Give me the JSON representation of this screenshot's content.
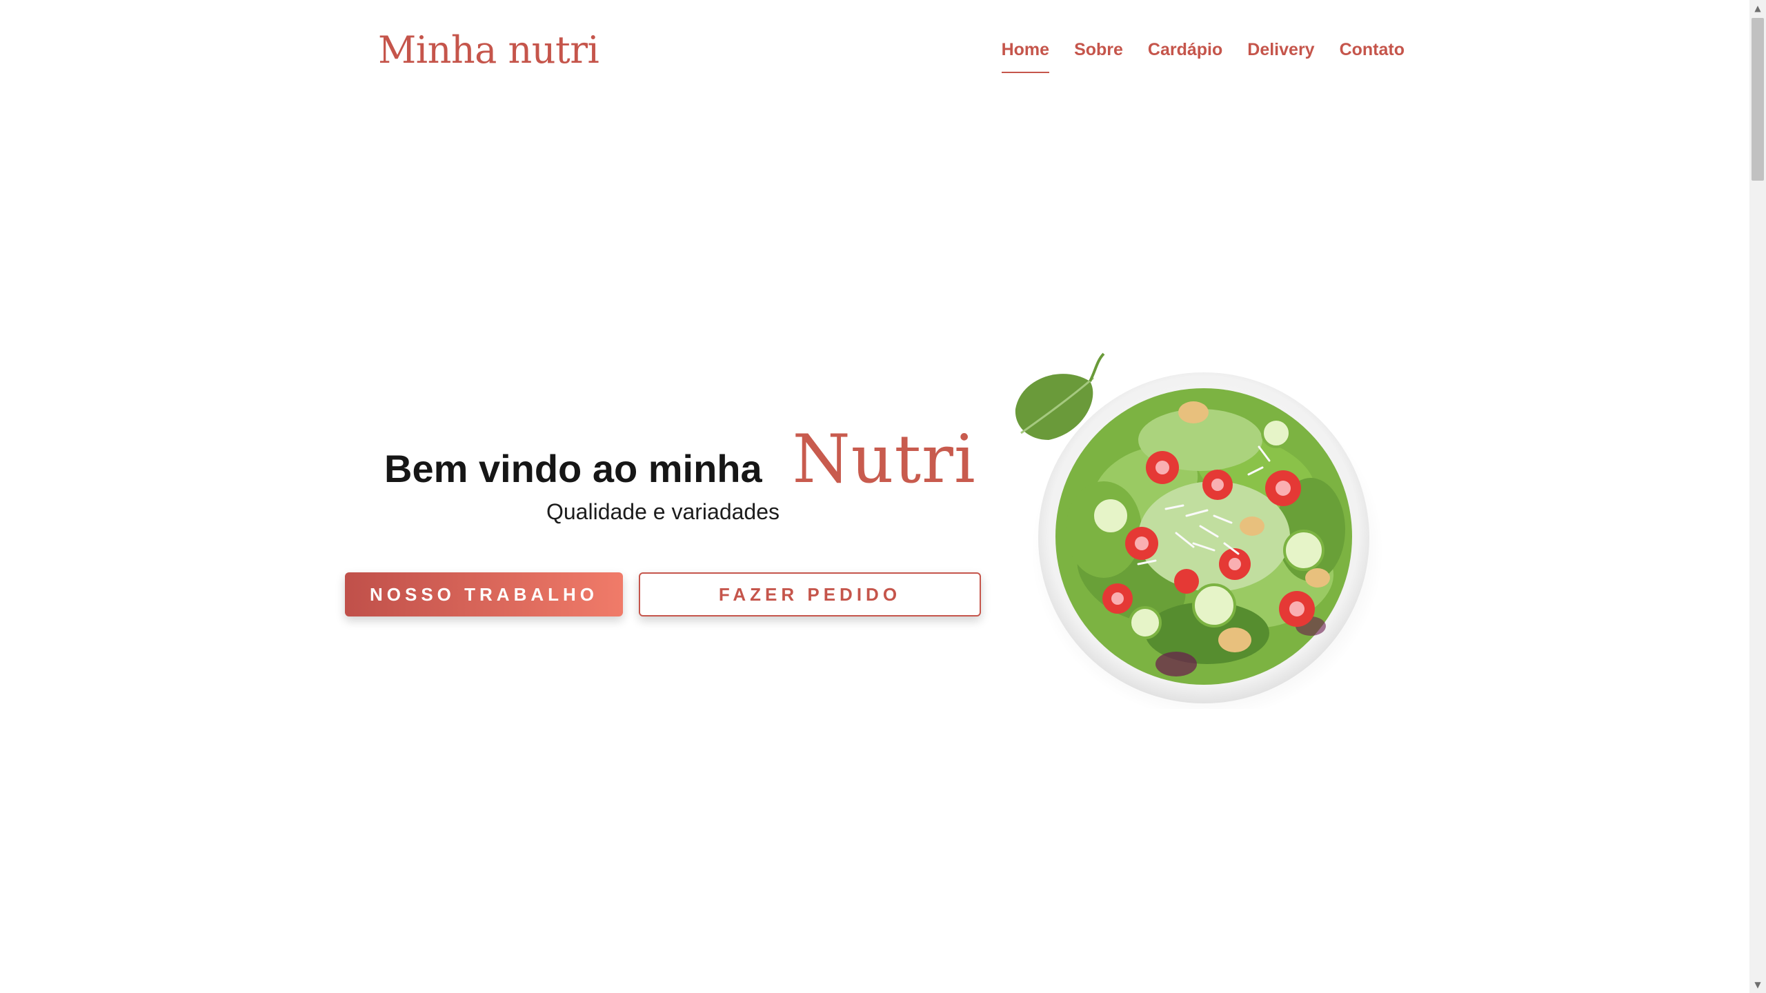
{
  "header": {
    "logo": "Minha nutri",
    "nav": [
      {
        "label": "Home",
        "active": true
      },
      {
        "label": "Sobre",
        "active": false
      },
      {
        "label": "Cardápio",
        "active": false
      },
      {
        "label": "Delivery",
        "active": false
      },
      {
        "label": "Contato",
        "active": false
      }
    ]
  },
  "hero": {
    "title": "Bem vindo ao minha",
    "title_accent": "Nutri",
    "subtitle": "Qualidade e variadades",
    "primary_button": "NOSSO TRABALHO",
    "secondary_button": "FAZER PEDIDO",
    "image": "salad-bowl-illustration"
  },
  "colors": {
    "brand": "#c5554b",
    "gradient_start": "#c0504a",
    "gradient_end": "#f07b69",
    "text_dark": "#161616"
  },
  "scrollbar": {
    "up_icon": "chevron-up-icon",
    "down_icon": "chevron-down-icon"
  }
}
